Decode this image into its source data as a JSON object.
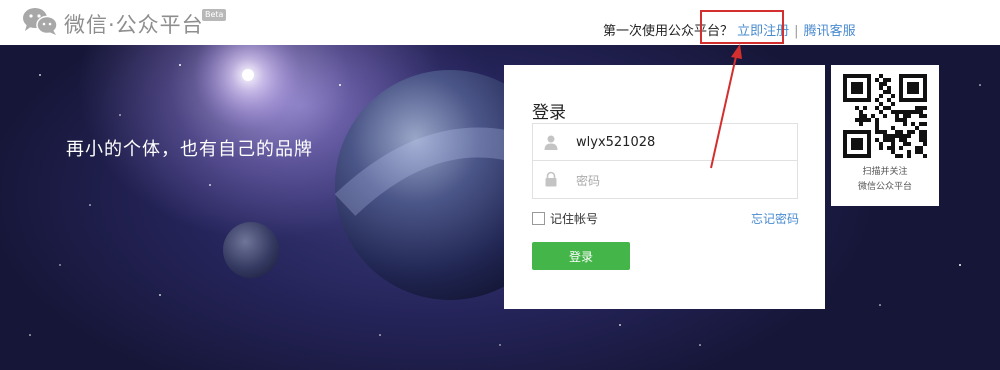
{
  "header": {
    "logo_icon": "wechat-bubbles-icon",
    "brand": "微信·公众平台",
    "beta": "Beta",
    "first_time_text": "第一次使用公众平台？",
    "register_link": "立即注册",
    "separator": "|",
    "support_link": "腾讯客服"
  },
  "banner": {
    "slogan": "再小的个体，也有自己的品牌"
  },
  "login": {
    "title": "登录",
    "username_icon": "user-icon",
    "username_value": "wlyx521028",
    "password_icon": "lock-icon",
    "password_placeholder": "密码",
    "remember_label": "记住帐号",
    "forgot_link": "忘记密码",
    "submit_label": "登录"
  },
  "qr": {
    "icon": "qr-code-icon",
    "line1": "扫描并关注",
    "line2": "微信公众平台"
  },
  "colors": {
    "accent_green": "#44b549",
    "link_blue": "#4a8bd0",
    "highlight_red": "#d32f2f"
  }
}
